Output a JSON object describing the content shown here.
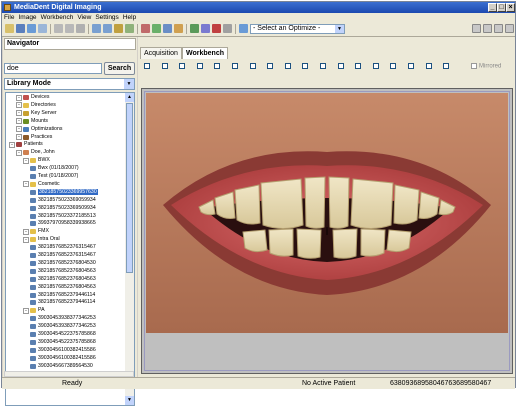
{
  "app": {
    "title": "MediaDent Digital Imaging"
  },
  "menu": [
    "File",
    "Image",
    "Workbench",
    "View",
    "Settings",
    "Help"
  ],
  "toolbar": {
    "optimize_select": "- Select an Optimize -"
  },
  "navigator": {
    "header": "Navigator",
    "search_value": "doe",
    "search_button": "Search",
    "library_mode": "Library Mode",
    "tree": [
      {
        "label": "Devices",
        "depth": 1,
        "icon": "devices-icon",
        "color": "#c0504d"
      },
      {
        "label": "Directories",
        "depth": 1,
        "icon": "folder-icon",
        "color": "#e4c04a"
      },
      {
        "label": "Key Server",
        "depth": 1,
        "icon": "key-icon",
        "color": "#c8a030"
      },
      {
        "label": "Mounts",
        "depth": 1,
        "icon": "mounts-icon",
        "color": "#6b8e23"
      },
      {
        "label": "Optimizations",
        "depth": 1,
        "icon": "optimizations-icon",
        "color": "#4a7ebb"
      },
      {
        "label": "Practices",
        "depth": 1,
        "icon": "practices-icon",
        "color": "#8b5a2b"
      },
      {
        "label": "Patients",
        "depth": 0,
        "icon": "patients-icon",
        "color": "#a04040"
      },
      {
        "label": "Doe, John",
        "depth": 1,
        "icon": "patient-icon",
        "color": "#d08050"
      },
      {
        "label": "BWX",
        "depth": 2,
        "icon": "folder-icon",
        "color": "#e4c04a"
      },
      {
        "label": "Bwx (01/18/2007)",
        "depth": 3,
        "icon": "image-icon",
        "color": "#5a7fb0"
      },
      {
        "label": "Test (01/18/2007)",
        "depth": 3,
        "icon": "image-icon",
        "color": "#5a7fb0"
      },
      {
        "label": "Cosmetic",
        "depth": 2,
        "icon": "folder-icon",
        "color": "#e4c04a"
      },
      {
        "label": "38218575023369957630",
        "depth": 3,
        "icon": "image-icon",
        "color": "#5a7fb0",
        "selected": true
      },
      {
        "label": "38218575023369059934",
        "depth": 3,
        "icon": "image-icon",
        "color": "#5a7fb0"
      },
      {
        "label": "38218575023369509934",
        "depth": 3,
        "icon": "image-icon",
        "color": "#5a7fb0"
      },
      {
        "label": "38218575023372185513",
        "depth": 3,
        "icon": "image-icon",
        "color": "#5a7fb0"
      },
      {
        "label": "39937970958339938665",
        "depth": 3,
        "icon": "image-icon",
        "color": "#5a7fb0"
      },
      {
        "label": "FMX",
        "depth": 2,
        "icon": "folder-icon",
        "color": "#e4c04a"
      },
      {
        "label": "Intra Oral",
        "depth": 2,
        "icon": "folder-icon",
        "color": "#e4c04a"
      },
      {
        "label": "38218576852376315467",
        "depth": 3,
        "icon": "image-icon",
        "color": "#5a7fb0"
      },
      {
        "label": "38218576852376315467",
        "depth": 3,
        "icon": "image-icon",
        "color": "#5a7fb0"
      },
      {
        "label": "38218576852376804530",
        "depth": 3,
        "icon": "image-icon",
        "color": "#5a7fb0"
      },
      {
        "label": "38218576852376804563",
        "depth": 3,
        "icon": "image-icon",
        "color": "#5a7fb0"
      },
      {
        "label": "38218576852376804563",
        "depth": 3,
        "icon": "image-icon",
        "color": "#5a7fb0"
      },
      {
        "label": "38218576852376804563",
        "depth": 3,
        "icon": "image-icon",
        "color": "#5a7fb0"
      },
      {
        "label": "38218576852379446114",
        "depth": 3,
        "icon": "image-icon",
        "color": "#5a7fb0"
      },
      {
        "label": "38218576852379446114",
        "depth": 3,
        "icon": "image-icon",
        "color": "#5a7fb0"
      },
      {
        "label": "PA",
        "depth": 2,
        "icon": "folder-icon",
        "color": "#e4c04a"
      },
      {
        "label": "39030453938377346253",
        "depth": 3,
        "icon": "image-icon",
        "color": "#5a7fb0"
      },
      {
        "label": "39030453938377346253",
        "depth": 3,
        "icon": "image-icon",
        "color": "#5a7fb0"
      },
      {
        "label": "39030454522375785868",
        "depth": 3,
        "icon": "image-icon",
        "color": "#5a7fb0"
      },
      {
        "label": "39030454522375785868",
        "depth": 3,
        "icon": "image-icon",
        "color": "#5a7fb0"
      },
      {
        "label": "39030456100382415586",
        "depth": 3,
        "icon": "image-icon",
        "color": "#5a7fb0"
      },
      {
        "label": "39030456100382415586",
        "depth": 3,
        "icon": "image-icon",
        "color": "#5a7fb0"
      },
      {
        "label": "3903045667389564530",
        "depth": 3,
        "icon": "image-icon",
        "color": "#5a7fb0"
      }
    ]
  },
  "workbench": {
    "tabs": [
      "Acquisition",
      "Workbench"
    ],
    "active_tab": 1,
    "mirrored_label": "Mirrored",
    "checkbox_count": 18
  },
  "status": {
    "left": "Ready",
    "patient": "No Active Patient",
    "id": "63809368958046763689580467"
  }
}
